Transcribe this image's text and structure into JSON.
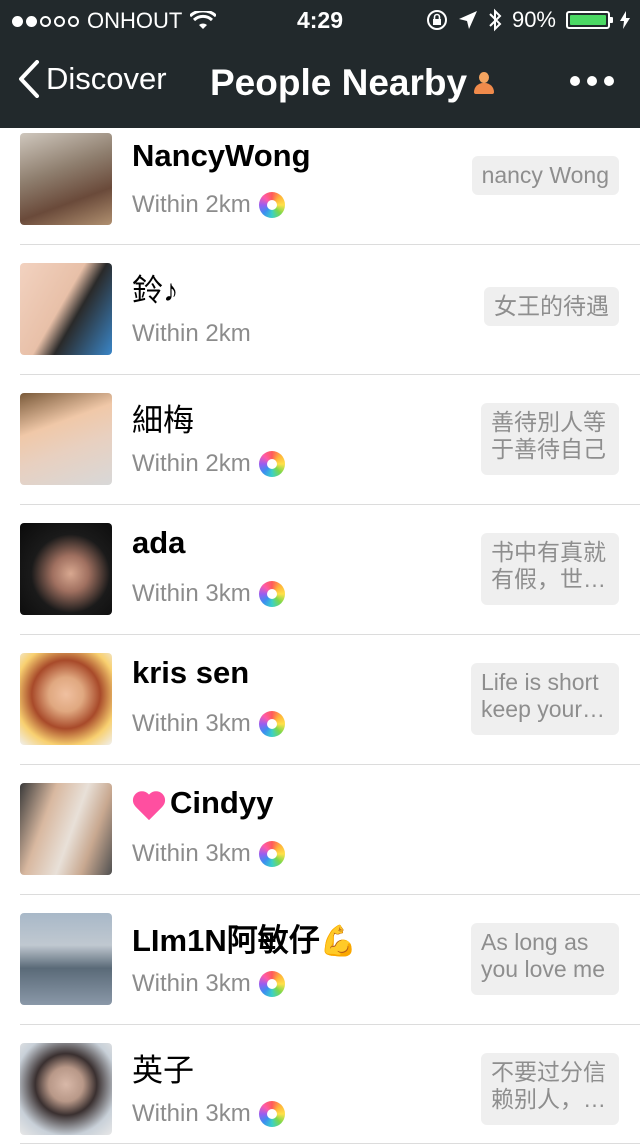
{
  "status_bar": {
    "carrier": "ONHOUT",
    "time": "4:29",
    "battery": "90%",
    "signal_bars_filled": 2,
    "signal_bars_total": 5
  },
  "nav": {
    "back_label": "Discover",
    "title": "People Nearby"
  },
  "people": [
    {
      "name": "NancyWong",
      "distance": "Within 2km",
      "moments": true,
      "signature": "nancy Wong"
    },
    {
      "name": "鈴♪",
      "distance": "Within 2km",
      "moments": false,
      "signature": "女王的待遇"
    },
    {
      "name": "細梅",
      "distance": "Within 2km",
      "moments": true,
      "signature": "善待別人等于善待自己"
    },
    {
      "name": "ada",
      "distance": "Within 3km",
      "moments": true,
      "signature": "书中有真就有假，世…"
    },
    {
      "name": "kris sen",
      "distance": "Within 3km",
      "moments": true,
      "signature": "Life is short keep your…"
    },
    {
      "name": "Cindyy",
      "distance": "Within 3km",
      "moments": true,
      "signature": ""
    },
    {
      "name": "LIm1N阿敏仔",
      "distance": "Within 3km",
      "moments": true,
      "signature": "As long as you love me"
    },
    {
      "name": "英子",
      "distance": "Within 3km",
      "moments": true,
      "signature": "不要过分信赖别人，…"
    }
  ],
  "colors": {
    "nav_bg": "#22292c",
    "battery": "#4cd964",
    "name_gray": "#8c8c8c",
    "sig_bg": "#efefef"
  }
}
